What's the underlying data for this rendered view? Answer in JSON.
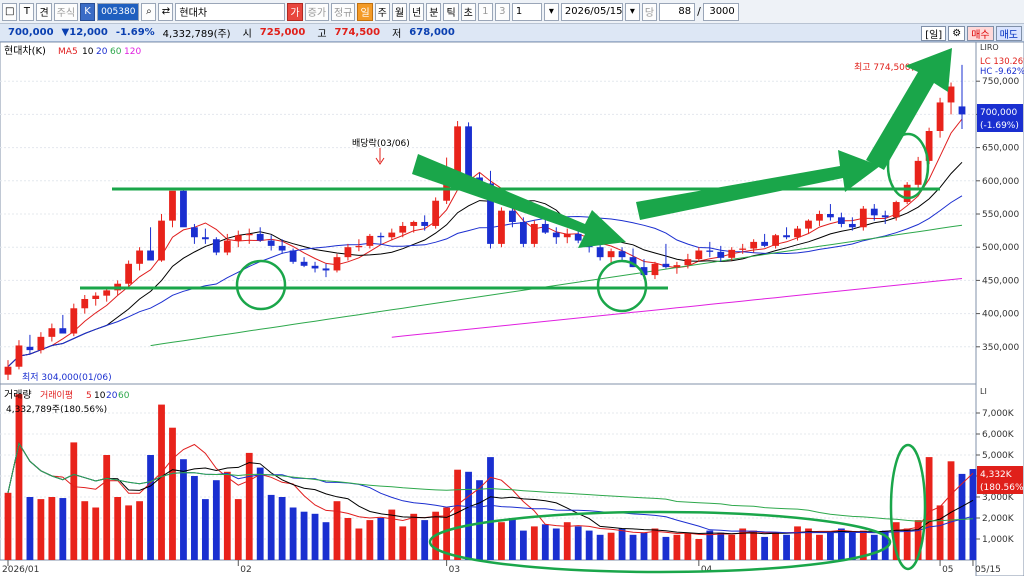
{
  "toolbar": {
    "btn1": "□",
    "btn2": "T",
    "btn3": "견",
    "btn4": "주식",
    "btn5": "K",
    "code": "005380",
    "search_icon": "search-icon",
    "swap_icon": "swap-icon",
    "stock_name": "현대차",
    "btn_ga": "가",
    "btn_jeungga": "증가",
    "btn_jeonggyu": "정규",
    "btn_il": "일",
    "period": [
      "주",
      "월",
      "년",
      "분",
      "틱",
      "초"
    ],
    "n1": "1",
    "n2": "3",
    "n3": "1",
    "date": "2026/05/15",
    "btn_dang": "당",
    "count": "88",
    "total": "3000"
  },
  "quote": {
    "price": "700,000",
    "change": "▼12,000",
    "pct": "-1.69%",
    "volume": "4,332,789(주)",
    "open_label": "시",
    "open": "725,000",
    "high_label": "고",
    "high": "774,500",
    "low_label": "저",
    "low": "678,000",
    "btn_il": "[일]",
    "buy": "매수",
    "sell": "매도"
  },
  "colors": {
    "up": "#e8231b",
    "down": "#1a2fd0",
    "annot": "#1aa64a"
  },
  "chart_data": {
    "type": "candlestick",
    "price_panel": {
      "title": "현대차(K)",
      "ma_label": "MA",
      "ma_periods": [
        "5",
        "10",
        "20",
        "60",
        "120"
      ],
      "ma_colors": [
        "#e01e1e",
        "#000000",
        "#1c2fd0",
        "#2ea84c",
        "#e020e0"
      ],
      "ylim": [
        300000,
        800000
      ],
      "y_ticks": [
        350000,
        400000,
        450000,
        500000,
        550000,
        600000,
        650000,
        700000,
        750000
      ],
      "y_tick_labels": [
        "350,000",
        "400,000",
        "450,000",
        "500,000",
        "550,000",
        "600,000",
        "650,000",
        "700,000",
        "750,000"
      ],
      "high_label": "최고 774,500(05/1",
      "low_label": "최저 304,000(01/06)",
      "dividend_label": "배당락(03/06)",
      "lc_label": "LC 130.26%",
      "hc_label": "HC -9.62%",
      "last_label": [
        "700,000",
        "(-1.69%)"
      ],
      "candles": [
        [
          308000,
          330000,
          300000,
          320000
        ],
        [
          320000,
          360000,
          316000,
          352000
        ],
        [
          350000,
          368000,
          340000,
          345000
        ],
        [
          345000,
          372000,
          340000,
          365000
        ],
        [
          365000,
          385000,
          358000,
          378000
        ],
        [
          378000,
          398000,
          372000,
          370000
        ],
        [
          370000,
          415000,
          366000,
          408000
        ],
        [
          408000,
          428000,
          400000,
          422000
        ],
        [
          422000,
          432000,
          412000,
          427000
        ],
        [
          427000,
          440000,
          418000,
          435000
        ],
        [
          435000,
          450000,
          428000,
          445000
        ],
        [
          445000,
          480000,
          440000,
          475000
        ],
        [
          475000,
          500000,
          465000,
          495000
        ],
        [
          495000,
          530000,
          488000,
          480000
        ],
        [
          480000,
          550000,
          478000,
          540000
        ],
        [
          540000,
          555000,
          530000,
          585000
        ],
        [
          585000,
          588000,
          540000,
          530000
        ],
        [
          530000,
          535000,
          505000,
          515000
        ],
        [
          515000,
          528000,
          505000,
          512000
        ],
        [
          512000,
          515000,
          488000,
          492000
        ],
        [
          492000,
          520000,
          488000,
          510000
        ],
        [
          510000,
          525000,
          500000,
          518000
        ],
        [
          518000,
          528000,
          505000,
          520000
        ],
        [
          520000,
          530000,
          508000,
          510000
        ],
        [
          510000,
          518000,
          495000,
          502000
        ],
        [
          502000,
          512000,
          490000,
          495000
        ],
        [
          495000,
          498000,
          475000,
          478000
        ],
        [
          478000,
          485000,
          470000,
          472000
        ],
        [
          472000,
          478000,
          462000,
          468000
        ],
        [
          468000,
          475000,
          455000,
          465000
        ],
        [
          465000,
          490000,
          462000,
          485000
        ],
        [
          485000,
          505000,
          480000,
          500000
        ],
        [
          500000,
          512000,
          494000,
          502000
        ],
        [
          502000,
          520000,
          498000,
          517000
        ],
        [
          517000,
          522000,
          505000,
          515000
        ],
        [
          515000,
          528000,
          510000,
          522000
        ],
        [
          522000,
          538000,
          515000,
          532000
        ],
        [
          532000,
          540000,
          522000,
          538000
        ],
        [
          538000,
          548000,
          525000,
          532000
        ],
        [
          532000,
          575000,
          528000,
          570000
        ],
        [
          570000,
          635000,
          565000,
          610000
        ],
        [
          610000,
          690000,
          600000,
          682000
        ],
        [
          682000,
          688000,
          600000,
          605000
        ],
        [
          605000,
          612000,
          590000,
          596000
        ],
        [
          596000,
          615000,
          498000,
          505000
        ],
        [
          505000,
          560000,
          500000,
          555000
        ],
        [
          555000,
          568000,
          530000,
          538000
        ],
        [
          538000,
          545000,
          500000,
          505000
        ],
        [
          505000,
          540000,
          500000,
          535000
        ],
        [
          535000,
          548000,
          520000,
          522000
        ],
        [
          522000,
          530000,
          505000,
          515000
        ],
        [
          515000,
          528000,
          506000,
          520000
        ],
        [
          520000,
          525000,
          506000,
          510000
        ],
        [
          510000,
          518000,
          492000,
          500000
        ],
        [
          500000,
          510000,
          480000,
          485000
        ],
        [
          485000,
          498000,
          476000,
          494000
        ],
        [
          494000,
          500000,
          478000,
          485000
        ],
        [
          485000,
          498000,
          470000,
          470000
        ],
        [
          470000,
          482000,
          452000,
          458000
        ],
        [
          458000,
          478000,
          452000,
          475000
        ],
        [
          475000,
          505000,
          468000,
          470000
        ],
        [
          470000,
          478000,
          460000,
          473000
        ],
        [
          473000,
          490000,
          468000,
          482000
        ],
        [
          482000,
          500000,
          478000,
          495000
        ],
        [
          495000,
          508000,
          485000,
          493000
        ],
        [
          493000,
          502000,
          478000,
          484000
        ],
        [
          484000,
          500000,
          480000,
          496000
        ],
        [
          496000,
          505000,
          490000,
          498000
        ],
        [
          498000,
          512000,
          492000,
          508000
        ],
        [
          508000,
          520000,
          500000,
          502000
        ],
        [
          502000,
          520000,
          498000,
          518000
        ],
        [
          518000,
          530000,
          512000,
          515000
        ],
        [
          515000,
          532000,
          510000,
          528000
        ],
        [
          528000,
          542000,
          520000,
          540000
        ],
        [
          540000,
          555000,
          532000,
          550000
        ],
        [
          550000,
          565000,
          540000,
          545000
        ],
        [
          545000,
          552000,
          530000,
          535000
        ],
        [
          535000,
          545000,
          525000,
          530000
        ],
        [
          530000,
          562000,
          525000,
          558000
        ],
        [
          558000,
          565000,
          540000,
          548000
        ],
        [
          548000,
          555000,
          535000,
          545000
        ],
        [
          545000,
          570000,
          540000,
          568000
        ],
        [
          568000,
          598000,
          565000,
          594000
        ],
        [
          594000,
          636000,
          590000,
          630000
        ],
        [
          630000,
          680000,
          625000,
          675000
        ],
        [
          675000,
          725000,
          665000,
          718000
        ],
        [
          718000,
          748000,
          700000,
          742000
        ],
        [
          712000,
          774500,
          678000,
          700000
        ]
      ]
    },
    "volume_panel": {
      "title": "거래량",
      "ma_label": "거래이평",
      "ma_periods": [
        "5",
        "10",
        "20",
        "60"
      ],
      "ma_colors": [
        "#e01e1e",
        "#000000",
        "#1c2fd0",
        "#2ea84c"
      ],
      "info": "4,332,789주(180.56%)",
      "ylim": [
        0,
        8000
      ],
      "y_ticks": [
        1000,
        2000,
        3000,
        4000,
        5000,
        6000,
        7000
      ],
      "y_tick_labels": [
        "1,000K",
        "2,000K",
        "3,000K",
        "4,000K",
        "5,000K",
        "6,000K",
        "7,000K"
      ],
      "unit": "K",
      "last_label": [
        "4,332K",
        "(180.56%)"
      ],
      "values": [
        3200,
        7900,
        3000,
        2900,
        3000,
        2950,
        5600,
        2800,
        2500,
        5000,
        3000,
        2600,
        2800,
        5000,
        7400,
        6300,
        4800,
        4000,
        2900,
        3800,
        4200,
        2900,
        5100,
        4400,
        3100,
        3000,
        2500,
        2300,
        2200,
        1800,
        2800,
        2000,
        1500,
        1900,
        2000,
        2400,
        1600,
        2200,
        1900,
        2300,
        2500,
        4300,
        4200,
        3800,
        4900,
        1800,
        2000,
        1400,
        1600,
        1700,
        1500,
        1800,
        1600,
        1400,
        1200,
        1300,
        1500,
        1200,
        1300,
        1500,
        1100,
        1200,
        1300,
        1000,
        1400,
        1300,
        1200,
        1500,
        1400,
        1100,
        1300,
        1200,
        1600,
        1500,
        1200,
        1300,
        1500,
        1300,
        1400,
        1200,
        1400,
        1800,
        1500,
        1900,
        4900,
        2600,
        4700,
        4100,
        4332
      ]
    },
    "x_tick_labels": [
      {
        "label": "2026/01",
        "index": 0
      },
      {
        "label": "02",
        "index": 21
      },
      {
        "label": "03",
        "index": 40
      },
      {
        "label": "04",
        "index": 63
      },
      {
        "label": "05",
        "index": 85
      },
      {
        "label": "05/15",
        "index": 88
      }
    ]
  }
}
